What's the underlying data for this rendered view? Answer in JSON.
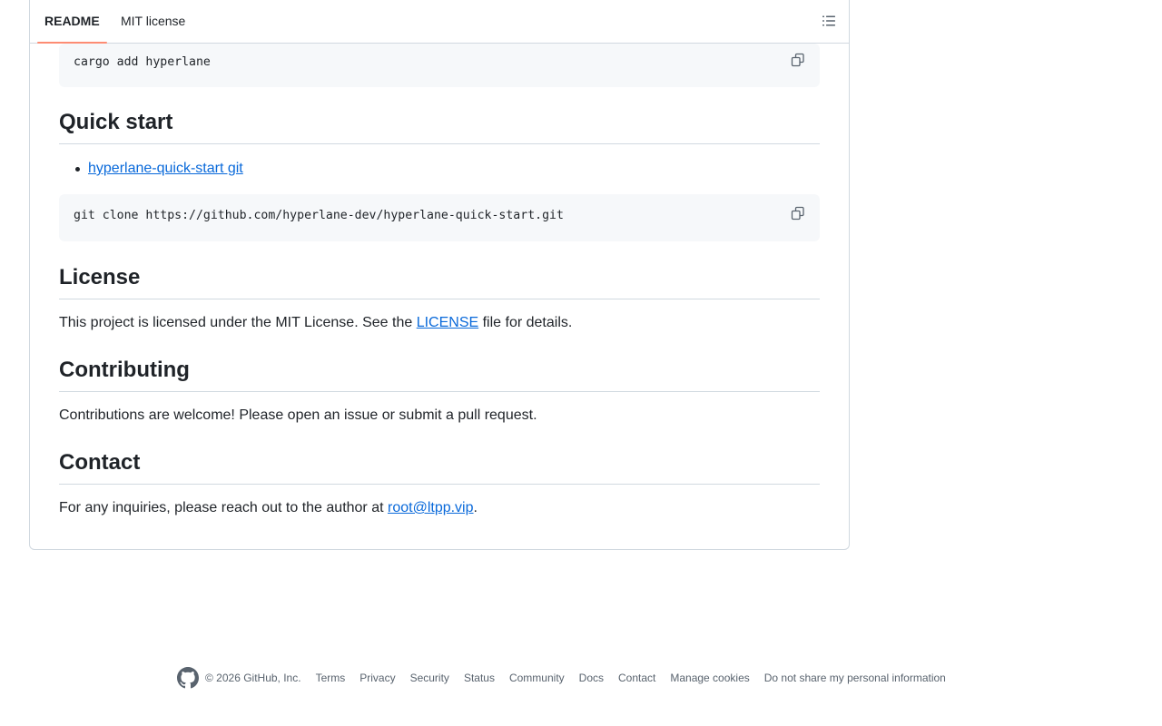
{
  "tabs": [
    {
      "label": "README"
    },
    {
      "label": "MIT license"
    }
  ],
  "toc_icon": "list-unordered-icon",
  "install_code": "cargo add hyperlane",
  "copy_icon": "copy-icon",
  "sections": {
    "quick_start": {
      "heading": "Quick start",
      "link_text": "hyperlane-quick-start git",
      "code": "git clone https://github.com/hyperlane-dev/hyperlane-quick-start.git"
    },
    "license": {
      "heading": "License",
      "text_before": "This project is licensed under the MIT License. See the ",
      "link_text": "LICENSE",
      "text_after": " file for details."
    },
    "contributing": {
      "heading": "Contributing",
      "text": "Contributions are welcome! Please open an issue or submit a pull request."
    },
    "contact": {
      "heading": "Contact",
      "text_before": "For any inquiries, please reach out to the author at ",
      "link_text": "root@ltpp.vip",
      "text_after": "."
    }
  },
  "footer": {
    "logo_icon": "github-mark-icon",
    "copyright": "© 2026 GitHub, Inc.",
    "links": [
      "Terms",
      "Privacy",
      "Security",
      "Status",
      "Community",
      "Docs",
      "Contact",
      "Manage cookies",
      "Do not share my personal information"
    ]
  },
  "colors": {
    "link": "#0969da",
    "tab_underline": "#fd8c73",
    "code_bg": "#f6f8fa",
    "border": "#d1d9e0",
    "muted_text": "#59636e"
  }
}
